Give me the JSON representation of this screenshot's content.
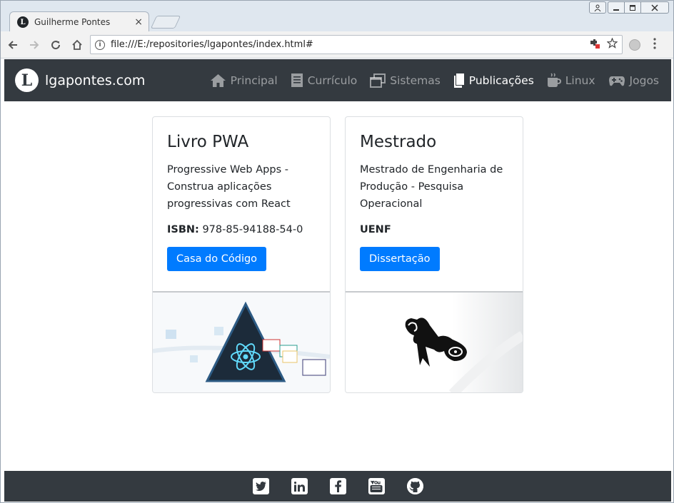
{
  "browser": {
    "tab_title": "Guilherme Pontes",
    "tab_close": "×",
    "url": "file:///E:/repositories/lgapontes/index.html#"
  },
  "navbar": {
    "brand_logo": "L",
    "brand": "lgapontes.com",
    "links": [
      {
        "label": "Principal",
        "icon": "home-icon",
        "active": false
      },
      {
        "label": "Currículo",
        "icon": "document-icon",
        "active": false
      },
      {
        "label": "Sistemas",
        "icon": "windows-icon",
        "active": false
      },
      {
        "label": "Publicações",
        "icon": "book-icon",
        "active": true
      },
      {
        "label": "Linux",
        "icon": "coffee-icon",
        "active": false
      },
      {
        "label": "Jogos",
        "icon": "gamepad-icon",
        "active": false
      }
    ]
  },
  "cards": [
    {
      "title": "Livro PWA",
      "text": "Progressive Web Apps - Construa aplicações progressivas com React",
      "meta_label": "ISBN:",
      "meta_value": "978-85-94188-54-0",
      "button": "Casa do Código",
      "image": "react-pwa-cover"
    },
    {
      "title": "Mestrado",
      "text": "Mestrado de Engenharia de Produção - Pesquisa Operacional",
      "meta_label": "UENF",
      "meta_value": "",
      "button": "Dissertação",
      "image": "diploma-scroll"
    }
  ],
  "footer": {
    "links": [
      {
        "name": "twitter-icon",
        "glyph": "t"
      },
      {
        "name": "linkedin-icon",
        "glyph": "in"
      },
      {
        "name": "facebook-icon",
        "glyph": "f"
      },
      {
        "name": "youtube-icon",
        "glyph": "You"
      },
      {
        "name": "github-icon",
        "glyph": "gh"
      }
    ]
  },
  "colors": {
    "navbar": "#343a40",
    "primary": "#007bff",
    "nav_inactive": "rgba(255,255,255,0.5)"
  }
}
